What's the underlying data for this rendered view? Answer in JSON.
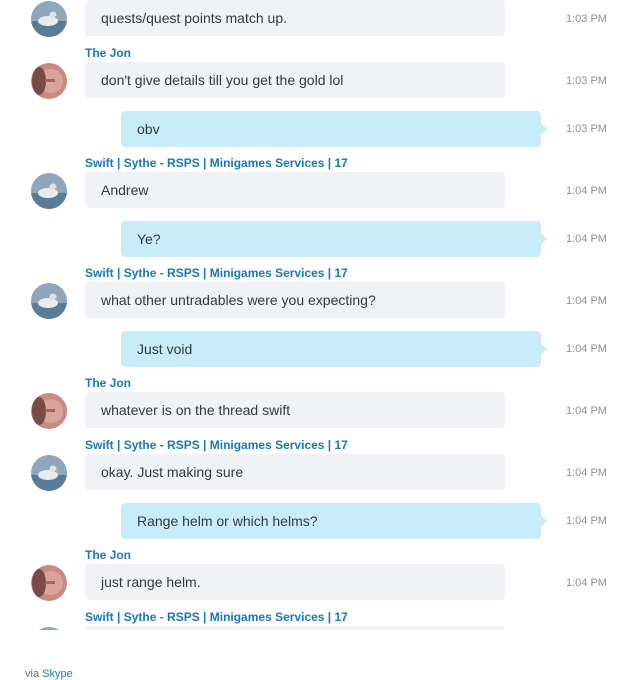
{
  "senders": {
    "jon": "The Jon",
    "swift": "Swift | Sythe - RSPS | Minigames Services | 17"
  },
  "messages": [
    {
      "text": "quests/quest points match up.",
      "time": "1:03 PM"
    },
    {
      "text": "don't give details till you get the gold lol",
      "time": "1:03 PM"
    },
    {
      "text": "obv",
      "time": "1:03 PM"
    },
    {
      "text": "Andrew",
      "time": "1:04 PM"
    },
    {
      "text": "Ye?",
      "time": "1:04 PM"
    },
    {
      "text": "what other untradables were you expecting?",
      "time": "1:04 PM"
    },
    {
      "text": "Just void",
      "time": "1:04 PM"
    },
    {
      "text": "whatever is on the thread swift",
      "time": "1:04 PM"
    },
    {
      "text": "okay. Just making sure",
      "time": "1:04 PM"
    },
    {
      "text": "Range helm or which helms?",
      "time": "1:04 PM"
    },
    {
      "text": "just range helm.",
      "time": "1:04 PM"
    }
  ],
  "footer": {
    "via": "via",
    "link": "Skype"
  }
}
